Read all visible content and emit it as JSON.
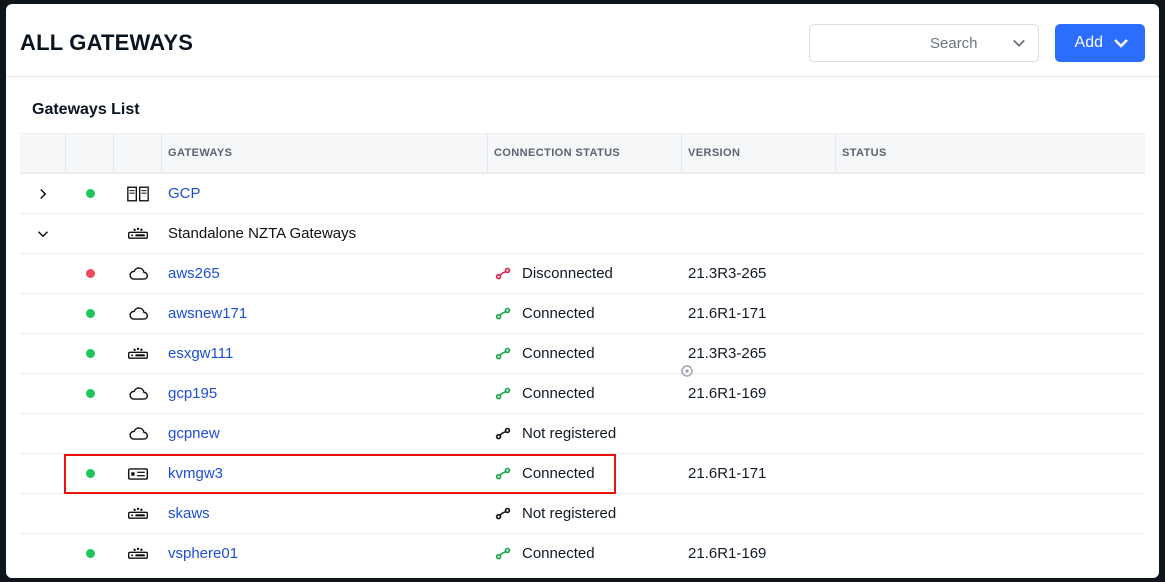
{
  "page": {
    "title": "ALL GATEWAYS"
  },
  "topbar": {
    "search_label": "Search",
    "add_label": "Add"
  },
  "list": {
    "title": "Gateways List"
  },
  "columns": {
    "gateways": "GATEWAYS",
    "connection": "CONNECTION STATUS",
    "version": "VERSION",
    "status": "STATUS"
  },
  "groups": [
    {
      "name": "GCP",
      "expanded": false,
      "status": "green",
      "icon": "datacenter"
    },
    {
      "name": "Standalone NZTA Gateways",
      "expanded": true,
      "status": "",
      "icon": "appliance"
    }
  ],
  "rows": [
    {
      "name": "aws265",
      "status": "red",
      "icon": "cloud",
      "conn": "Disconnected",
      "conn_color": "red",
      "version": "21.3R3-265"
    },
    {
      "name": "awsnew171",
      "status": "green",
      "icon": "cloud",
      "conn": "Connected",
      "conn_color": "green",
      "version": "21.6R1-171"
    },
    {
      "name": "esxgw111",
      "status": "green",
      "icon": "appliance",
      "conn": "Connected",
      "conn_color": "green",
      "version": "21.3R3-265"
    },
    {
      "name": "gcp195",
      "status": "green",
      "icon": "cloud",
      "conn": "Connected",
      "conn_color": "green",
      "version": "21.6R1-169"
    },
    {
      "name": "gcpnew",
      "status": "",
      "icon": "cloud",
      "conn": "Not registered",
      "conn_color": "black",
      "version": ""
    },
    {
      "name": "kvmgw3",
      "status": "green",
      "icon": "card",
      "conn": "Connected",
      "conn_color": "green",
      "version": "21.6R1-171",
      "highlight": true
    },
    {
      "name": "skaws",
      "status": "",
      "icon": "appliance",
      "conn": "Not registered",
      "conn_color": "black",
      "version": ""
    },
    {
      "name": "vsphere01",
      "status": "green",
      "icon": "appliance",
      "conn": "Connected",
      "conn_color": "green",
      "version": "21.6R1-169"
    }
  ]
}
